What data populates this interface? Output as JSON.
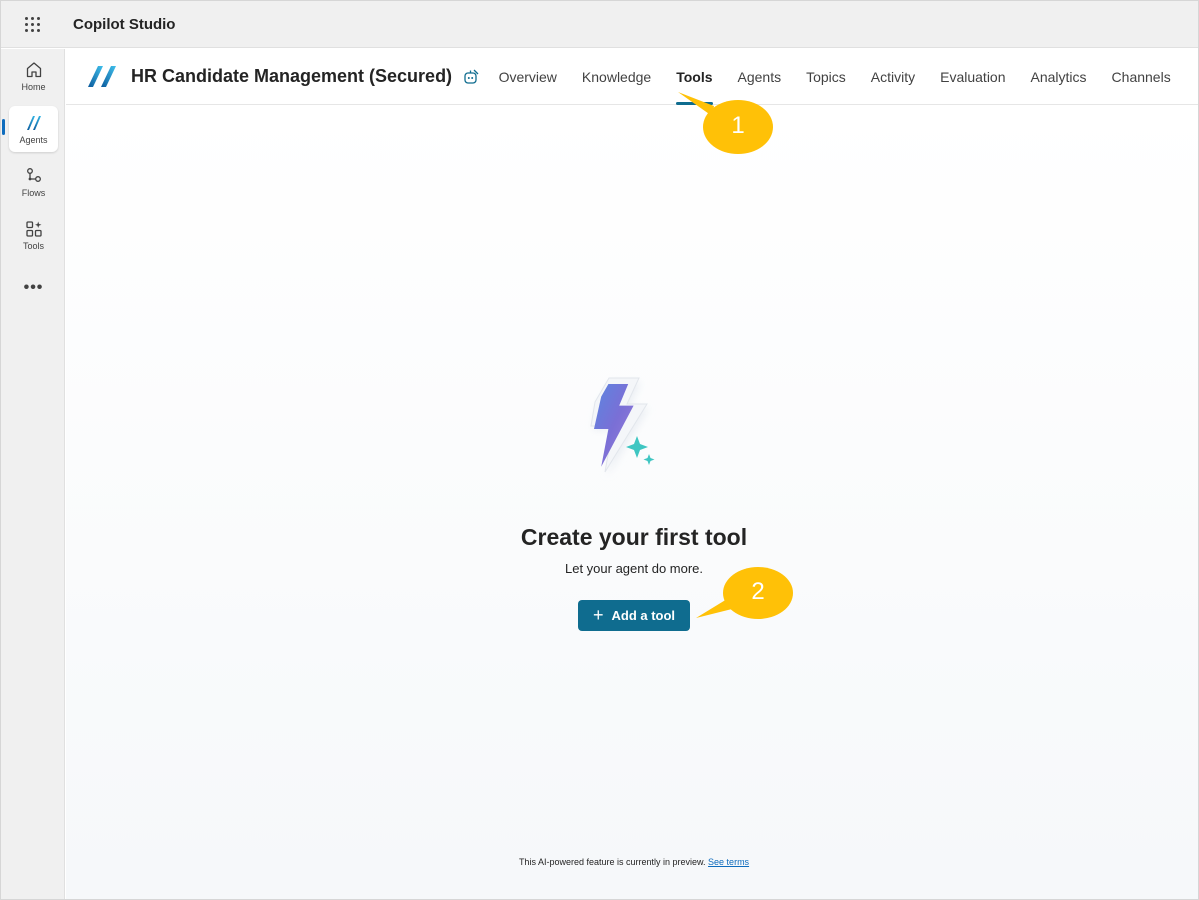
{
  "app": {
    "title": "Copilot Studio"
  },
  "rail": {
    "items": [
      {
        "label": "Home",
        "icon": "home-icon"
      },
      {
        "label": "Agents",
        "icon": "agents-icon"
      },
      {
        "label": "Flows",
        "icon": "flows-icon"
      },
      {
        "label": "Tools",
        "icon": "tools-icon"
      }
    ],
    "more": "•••"
  },
  "agent": {
    "name": "HR Candidate Management (Secured)",
    "tabs": [
      {
        "label": "Overview",
        "active": false
      },
      {
        "label": "Knowledge",
        "active": false
      },
      {
        "label": "Tools",
        "active": true
      },
      {
        "label": "Agents",
        "active": false
      },
      {
        "label": "Topics",
        "active": false
      },
      {
        "label": "Activity",
        "active": false
      },
      {
        "label": "Evaluation",
        "active": false
      },
      {
        "label": "Analytics",
        "active": false
      },
      {
        "label": "Channels",
        "active": false
      }
    ]
  },
  "main": {
    "headline": "Create your first tool",
    "subline": "Let your agent do more.",
    "add_button": "Add a tool",
    "footer_text": "This AI-powered feature is currently in preview.",
    "footer_link": "See terms"
  },
  "callouts": [
    {
      "number": "1"
    },
    {
      "number": "2"
    }
  ],
  "colors": {
    "accent": "#0f6c8f",
    "callout": "#ffc107",
    "rail_bg": "#f0f0f0"
  }
}
